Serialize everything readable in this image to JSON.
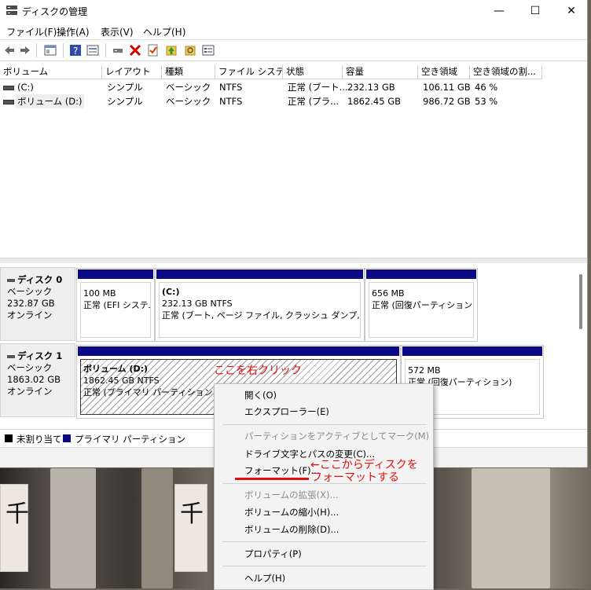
{
  "window": {
    "title": "ディスクの管理",
    "minimize": "—",
    "maximize": "☐",
    "close": "✕"
  },
  "menu": [
    "ファイル(F)",
    "操作(A)",
    "表示(V)",
    "ヘルプ(H)"
  ],
  "toolbar_icons": [
    "back-icon",
    "forward-icon",
    "properties-pane-icon",
    "help-icon",
    "view-icon",
    "connect-icon",
    "delete-icon",
    "check-icon",
    "up-icon",
    "search-icon",
    "list-icon"
  ],
  "columns": [
    "ボリューム",
    "レイアウト",
    "種類",
    "ファイル システム",
    "状態",
    "容量",
    "空き領域",
    "空き領域の割..."
  ],
  "volumes": [
    {
      "name": "(C:)",
      "layout": "シンプル",
      "type": "ベーシック",
      "fs": "NTFS",
      "status": "正常 (ブート...",
      "capacity": "232.13 GB",
      "free": "106.11 GB",
      "pct": "46 %"
    },
    {
      "name": "ボリューム (D:)",
      "layout": "シンプル",
      "type": "ベーシック",
      "fs": "NTFS",
      "status": "正常 (プラ...",
      "capacity": "1862.45 GB",
      "free": "986.72 GB",
      "pct": "53 %"
    }
  ],
  "disks": [
    {
      "name": "ディスク 0",
      "kind": "ベーシック",
      "size": "232.87 GB",
      "state": "オンライン",
      "partitions": [
        {
          "title": "",
          "line1": "100 MB",
          "line2": "正常 (EFI システム"
        },
        {
          "title": "(C:)",
          "line1": "232.13 GB NTFS",
          "line2": "正常 (ブート, ページ ファイル, クラッシュ ダンプ, ベーシック"
        },
        {
          "title": "",
          "line1": "656 MB",
          "line2": "正常 (回復パーティション)"
        }
      ]
    },
    {
      "name": "ディスク 1",
      "kind": "ベーシック",
      "size": "1863.02 GB",
      "state": "オンライン",
      "partitions": [
        {
          "title": "ボリューム (D:)",
          "line1": "1862.45 GB NTFS",
          "line2": "正常 (プライマリ パーティション)"
        },
        {
          "title": "",
          "line1": "572 MB",
          "line2": "正常 (回復パーティション)"
        }
      ]
    }
  ],
  "legend": [
    "未割り当て",
    "プライマリ パーティション"
  ],
  "annotations": {
    "right_click": "ここを右クリック",
    "format_line1": "←ここからディスクを",
    "format_line2": "フォーマットする"
  },
  "context_menu": [
    {
      "label": "開く(O)",
      "enabled": true
    },
    {
      "label": "エクスプローラー(E)",
      "enabled": true
    },
    {
      "label": "パーティションをアクティブとしてマーク(M)",
      "enabled": false
    },
    {
      "label": "ドライブ文字とパスの変更(C)...",
      "enabled": true
    },
    {
      "label": "フォーマット(F)...",
      "enabled": true
    },
    {
      "label": "ボリュームの拡張(X)...",
      "enabled": false
    },
    {
      "label": "ボリュームの縮小(H)...",
      "enabled": true
    },
    {
      "label": "ボリュームの削除(D)...",
      "enabled": true
    },
    {
      "label": "プロパティ(P)",
      "enabled": true
    },
    {
      "label": "ヘルプ(H)",
      "enabled": true
    }
  ],
  "colors": {
    "primary_partition": "#0a0a86",
    "unallocated": "#000000",
    "annotation": "#e01010"
  }
}
